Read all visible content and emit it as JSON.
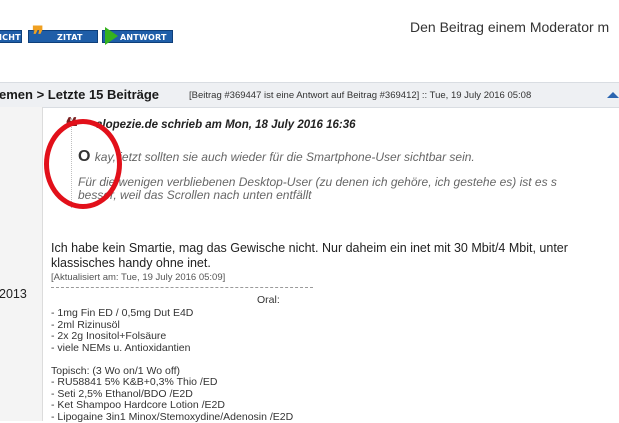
{
  "toolbar": {
    "partial_button_label": "ICHT",
    "quote_button_label": "ZITAT",
    "reply_button_label": "ANTWORT",
    "report_text": "Den Beitrag einem Moderator m"
  },
  "post_header": {
    "breadcrumb": "emen > Letzte 15 Beiträge",
    "meta": "[Beitrag #369447 ist eine Antwort auf Beitrag #369412] :: Tue, 19 July 2016 05:08"
  },
  "author_info": {
    "join_year": "2013"
  },
  "quote": {
    "author_line": "alopezie.de schrieb am Mon, 18 July 2016 16:36",
    "line1_dropcap": "O",
    "line1_rest": "kay, jetzt sollten sie auch wieder für die Smartphone-User sichtbar sein.",
    "line2": "Für die wenigen verbliebenen Desktop-User (zu denen ich gehöre, ich gestehe es) ist es s",
    "line3": "besser, weil das Scrollen nach unten entfällt"
  },
  "post": {
    "body_line1": "Ich habe kein Smartie, mag das Gewische nicht. Nur daheim ein inet mit 30 Mbit/4 Mbit, unter",
    "body_line2": "klassisches handy ohne inet.",
    "edited": "[Aktualisiert am: Tue, 19 July 2016 05:09]"
  },
  "signature": {
    "oral_heading": "Oral:",
    "lines": [
      "- 1mg Fin ED / 0,5mg Dut E4D",
      "- 2ml Rizinusöl",
      "- 2x 2g Inositol+Folsäure",
      "- viele NEMs u. Antioxidantien",
      "",
      "Topisch: (3 Wo on/1 Wo off)",
      "- RU58841 5% K&B+0,3% Thio /ED",
      "- Seti 2,5% Ethanol/BDO /E2D",
      "- Ket Shampoo Hardcore Lotion /E2D",
      "- Lipogaine 3in1 Minox/Stemoxydine/Adenosin /E2D"
    ]
  },
  "colors": {
    "button_blue": "#1f5ea8",
    "quote_orange": "#f0a020",
    "reply_green": "#35b21f",
    "annotation_red": "#e2101a"
  }
}
